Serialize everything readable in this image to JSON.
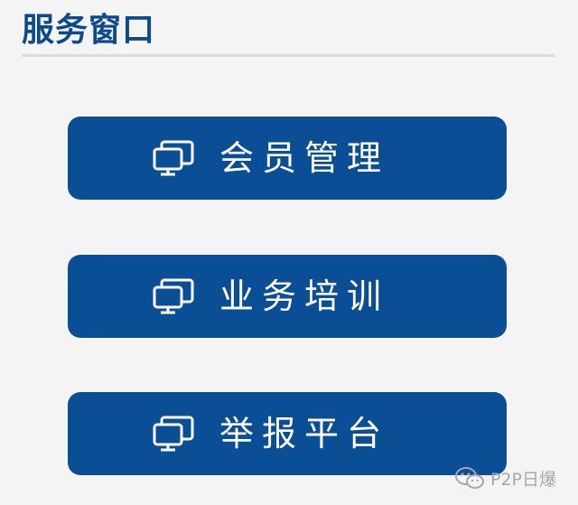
{
  "header": {
    "title": "服务窗口"
  },
  "buttons": [
    {
      "label": "会员管理",
      "icon": "monitor-icon"
    },
    {
      "label": "业务培训",
      "icon": "monitor-icon"
    },
    {
      "label": "举报平台",
      "icon": "monitor-icon"
    }
  ],
  "watermark": {
    "text": "P2P日爆",
    "icon": "wechat-icon"
  },
  "colors": {
    "background": "#f4f4f4",
    "accent": "#0a4f95",
    "title": "#0c4a8d",
    "button_text": "#ffffff"
  }
}
